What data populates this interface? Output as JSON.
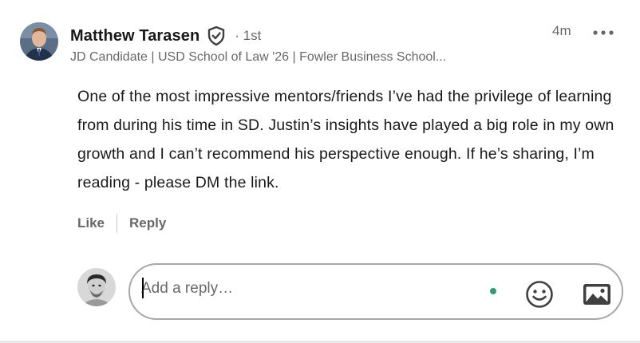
{
  "comment": {
    "author_name": "Matthew Tarasen",
    "connection_degree": "· 1st",
    "headline": "JD Candidate | USD School of Law '26 | Fowler Business School...",
    "timestamp": "4m",
    "body": "One of the most impressive mentors/friends I’ve had the privilege of learning from during his time in SD. Justin’s insights have played a big role in my own growth and I can’t recommend his perspective enough. If he’s sharing, I’m reading - please DM the link.",
    "icons": {
      "verified": "verified-shield-icon",
      "more": "ellipsis-icon"
    }
  },
  "actions": {
    "like_label": "Like",
    "reply_label": "Reply"
  },
  "reply_composer": {
    "placeholder": "Add a reply…",
    "value": "",
    "status_color": "#2e9e6e",
    "icons": {
      "emoji": "emoji-icon",
      "image": "image-icon"
    }
  }
}
